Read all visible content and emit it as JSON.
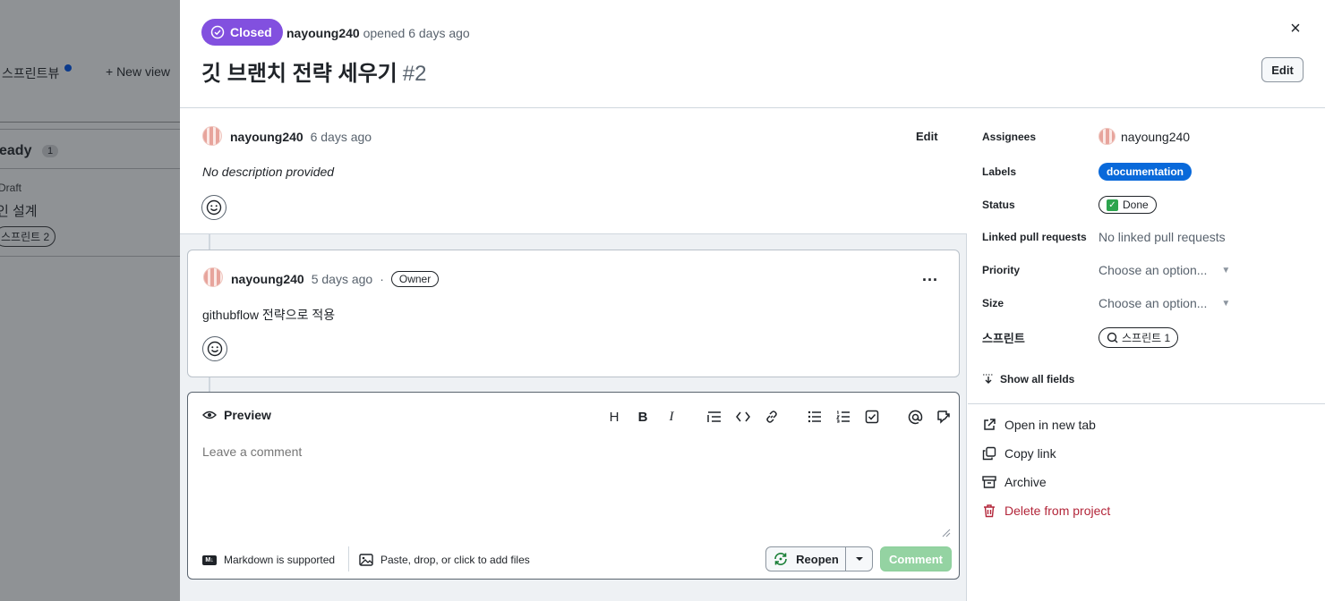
{
  "background": {
    "view_name": "스프린트뷰",
    "new_view": "+ New view",
    "column_title": "eady",
    "column_count": "1",
    "card_type": "Draft",
    "card_title": "인 설계",
    "card_iteration": "스프린트 2"
  },
  "header": {
    "state": "Closed",
    "author": "nayoung240",
    "opened_text": "opened 6 days ago",
    "title": "깃 브랜치 전략 세우기",
    "number": "#2",
    "close": "×",
    "edit_label": "Edit"
  },
  "description": {
    "author": "nayoung240",
    "time": "6 days ago",
    "edit_label": "Edit",
    "body": "No description provided"
  },
  "comment": {
    "author": "nayoung240",
    "time": "5 days ago",
    "separator": "·",
    "role": "Owner",
    "more": "...",
    "body": "githubflow 전략으로 적용"
  },
  "editor": {
    "tab": "Preview",
    "placeholder": "Leave a comment",
    "markdown_note": "Markdown is supported",
    "paste_note": "Paste, drop, or click to add files",
    "reopen_label": "Reopen",
    "comment_label": "Comment",
    "toolbar": [
      "H",
      "B",
      "I"
    ]
  },
  "sidebar": {
    "assignees_label": "Assignees",
    "assignee": "nayoung240",
    "labels_label": "Labels",
    "label_value": "documentation",
    "status_label": "Status",
    "status_value": "Done",
    "linked_label": "Linked pull requests",
    "linked_value": "No linked pull requests",
    "priority_label": "Priority",
    "priority_value": "Choose an option...",
    "size_label": "Size",
    "size_value": "Choose an option...",
    "iteration_label": "스프린트",
    "iteration_value": "스프린트 1",
    "show_all": "Show all fields",
    "actions": {
      "open_tab": "Open in new tab",
      "copy_link": "Copy link",
      "archive": "Archive",
      "delete": "Delete from project"
    }
  },
  "colors": {
    "closed": "#8250df",
    "label": "#0969da",
    "done": "#2da44e",
    "danger": "#b3263a",
    "comment_button": "#94d3a2"
  }
}
